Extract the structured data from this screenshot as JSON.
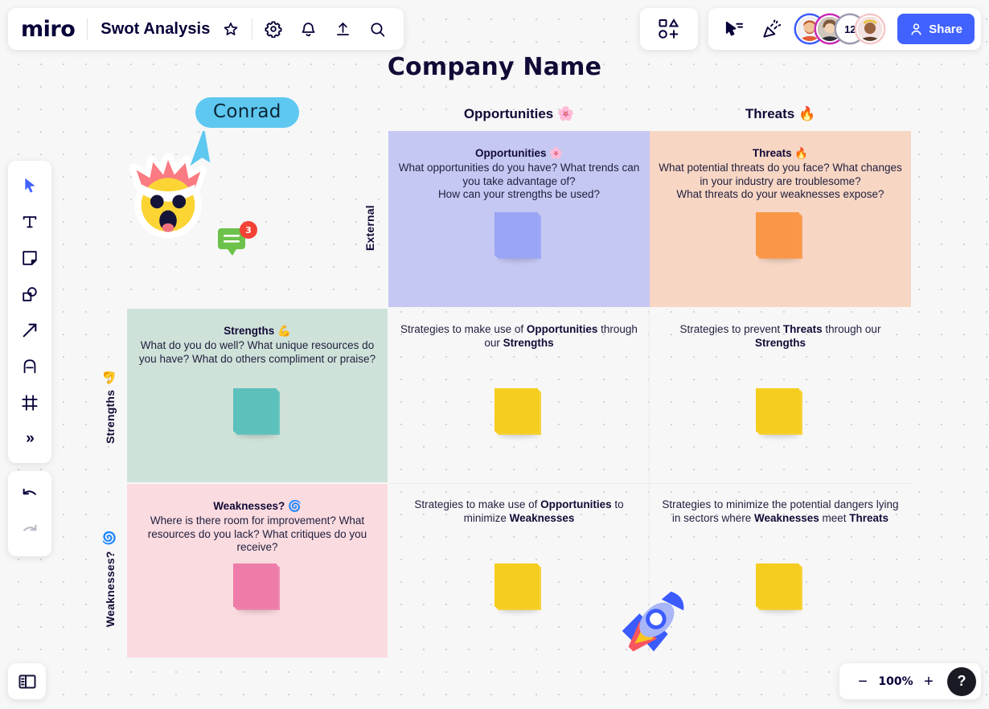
{
  "app": {
    "logo_text": "miro",
    "board_title": "Swot Analysis",
    "icons": {
      "star": "star-icon",
      "settings": "gear-icon",
      "notifications": "bell-icon",
      "upload": "upload-icon",
      "search": "search-icon",
      "shapes": "shapes-icon",
      "cursor_share": "cursor-share-icon",
      "celebrate": "party-popper-icon"
    }
  },
  "collaborators": {
    "overflow_count": "12",
    "share_label": "Share"
  },
  "tools": [
    {
      "name": "select-tool",
      "icon": "cursor-icon",
      "selected": true
    },
    {
      "name": "text-tool",
      "icon": "text-icon",
      "selected": false
    },
    {
      "name": "sticky-tool",
      "icon": "sticky-note-icon",
      "selected": false
    },
    {
      "name": "shapes-tool",
      "icon": "shapes-icon",
      "selected": false
    },
    {
      "name": "arrow-tool",
      "icon": "arrow-icon",
      "selected": false
    },
    {
      "name": "pen-tool",
      "icon": "pen-icon",
      "selected": false
    },
    {
      "name": "frame-tool",
      "icon": "frame-icon",
      "selected": false
    },
    {
      "name": "more-tools",
      "icon": "chevron-right-double-icon",
      "selected": false
    }
  ],
  "history": {
    "undo": "undo-icon",
    "redo": "redo-icon"
  },
  "zoom": {
    "minus_label": "−",
    "level": "100%",
    "plus_label": "+",
    "help_label": "?"
  },
  "panel": {
    "toggle_icon": "sidebar-panel-icon"
  },
  "cursor": {
    "user_name": "Conrad",
    "comment_count": "3",
    "sticker": "exploding-head-emoji"
  },
  "board": {
    "title": "Company Name",
    "column_headers": [
      {
        "label": "Opportunities 🌸"
      },
      {
        "label": "Threats 🔥"
      }
    ],
    "axis_labels": {
      "external": "External",
      "strengths": "Strengths",
      "strengths_emoji": "💪",
      "weaknesses": "Weaknesses?",
      "weaknesses_emoji": "🌀"
    },
    "quadrants": {
      "opportunities": {
        "title": "Opportunities 🌸",
        "body": "What opportunities do you have? What trends can you take advantage of?\nHow can your strengths be used?",
        "color": "#c5c8f2",
        "sticky_color": "#9aa4f4"
      },
      "threats": {
        "title": "Threats 🔥",
        "body": "What potential threats do you face? What changes in your industry are troublesome?\nWhat threats do your weaknesses expose?",
        "color": "#f7d6c4",
        "sticky_color": "#f99746"
      },
      "strengths": {
        "title": "Strengths 💪",
        "body": "What do you do well? What unique resources do you have? What do others compliment or praise?",
        "color": "#cfe2d9",
        "sticky_color": "#5cc0bb"
      },
      "weaknesses": {
        "title": "Weaknesses? 🌀",
        "body": "Where is there room for improvement? What resources do you lack? What critiques do you receive?",
        "color": "#fadbe0",
        "sticky_color": "#ed7ca8"
      }
    },
    "strategies": [
      {
        "name": "so-strategy",
        "parts": [
          {
            "t": "Strategies to make use of ",
            "b": false
          },
          {
            "t": "Opportunities",
            "b": true
          },
          {
            "t": " through our ",
            "b": false
          },
          {
            "t": "Strengths",
            "b": true
          }
        ],
        "sticky_color": "#f5cd1e"
      },
      {
        "name": "st-strategy",
        "parts": [
          {
            "t": "Strategies to prevent ",
            "b": false
          },
          {
            "t": "Threats",
            "b": true
          },
          {
            "t": " through our ",
            "b": false
          },
          {
            "t": "Strengths",
            "b": true
          }
        ],
        "sticky_color": "#f5cd1e"
      },
      {
        "name": "wo-strategy",
        "parts": [
          {
            "t": "Strategies to make use of ",
            "b": false
          },
          {
            "t": "Opportunities",
            "b": true
          },
          {
            "t": " to minimize ",
            "b": false
          },
          {
            "t": "Weaknesses",
            "b": true
          }
        ],
        "sticky_color": "#f5cd1e"
      },
      {
        "name": "wt-strategy",
        "parts": [
          {
            "t": "Strategies to minimize the potential dangers lying in sectors where ",
            "b": false
          },
          {
            "t": "Weaknesses",
            "b": true
          },
          {
            "t": " meet ",
            "b": false
          },
          {
            "t": "Threats",
            "b": true
          }
        ],
        "sticky_color": "#f5cd1e"
      }
    ],
    "decoration": {
      "rocket": "rocket-illustration"
    }
  },
  "colors": {
    "brand": "#4262ff",
    "ink": "#110a36",
    "cursor_blue": "#5ec8f0",
    "comment_green": "#6cc24a",
    "badge_red": "#f24236"
  }
}
